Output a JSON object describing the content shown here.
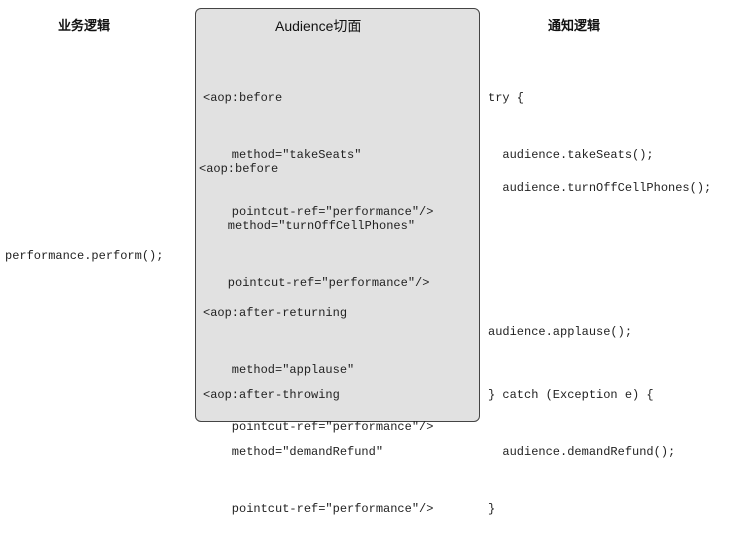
{
  "headers": {
    "left": "业务逻辑",
    "center": "Audience切面",
    "right": "通知逻辑"
  },
  "business": {
    "call": "performance.perform();"
  },
  "aspect": {
    "before1": [
      "<aop:before",
      "    method=\"takeSeats\"",
      "    pointcut-ref=\"performance\"/>"
    ],
    "before2": [
      "<aop:before",
      "    method=\"turnOffCellPhones\"",
      "    pointcut-ref=\"performance\"/>"
    ],
    "after_returning": [
      "<aop:after-returning",
      "    method=\"applause\"",
      "    pointcut-ref=\"performance\"/>"
    ],
    "after_throwing": [
      "<aop:after-throwing",
      "    method=\"demandRefund\"",
      "    pointcut-ref=\"performance\"/>"
    ]
  },
  "advice": {
    "try_open": "try {",
    "take_seats": "  audience.takeSeats();",
    "turn_off": "  audience.turnOffCellPhones();",
    "applause": "audience.applause();",
    "catch_open": "} catch (Exception e) {",
    "demand_refund": "  audience.demandRefund();",
    "close": "}"
  }
}
